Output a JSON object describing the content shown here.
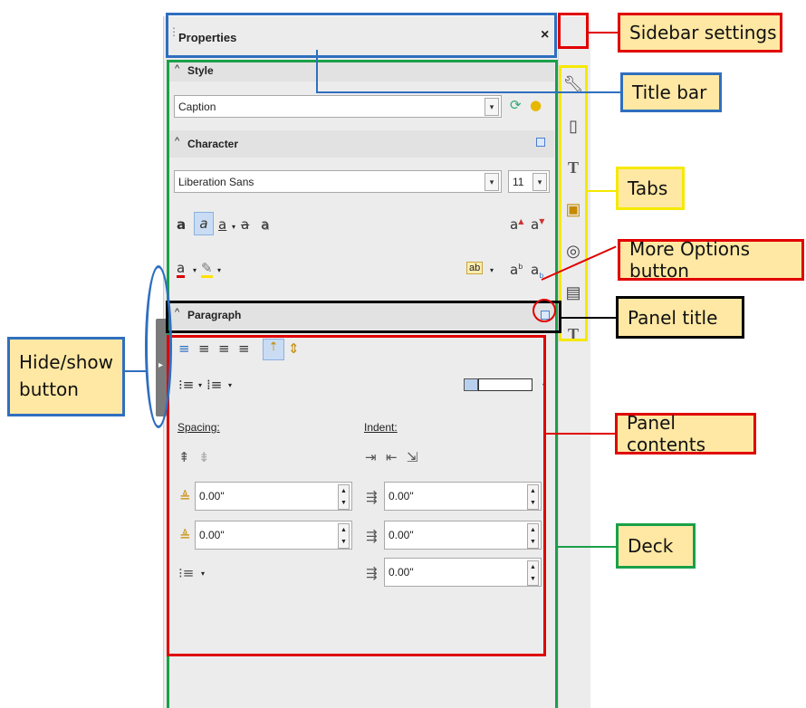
{
  "sidebar": {
    "title": "Properties",
    "close_glyph": "×",
    "menu_glyph": ":",
    "panels": {
      "style": {
        "title": "Style",
        "value": "Caption"
      },
      "character": {
        "title": "Character",
        "font_name": "Liberation Sans",
        "font_size": "11"
      },
      "paragraph": {
        "title": "Paragraph",
        "spacing_label": "Spacing:",
        "indent_label": "Indent:",
        "above_spacing": "0.00\"",
        "below_spacing": "0.00\"",
        "before_indent": "0.00\"",
        "after_indent": "0.00\"",
        "first_line_indent": "0.00\""
      }
    },
    "tabs": [
      "wrench-icon",
      "page-icon",
      "styles-icon",
      "gallery-icon",
      "navigator-icon",
      "manage-changes-icon",
      "design-icon"
    ]
  },
  "callouts": {
    "sidebar_settings": "Sidebar settings",
    "title_bar": "Title bar",
    "tabs": "Tabs",
    "more_options": "More Options button",
    "panel_title": "Panel title",
    "panel_contents": "Panel contents",
    "deck": "Deck",
    "hide_show": "Hide/show button"
  },
  "colors": {
    "red": "#e00000",
    "blue": "#2f6fbf",
    "green": "#1aa04a",
    "yellow": "#f5e900",
    "callout_bg": "#ffe8a3"
  }
}
